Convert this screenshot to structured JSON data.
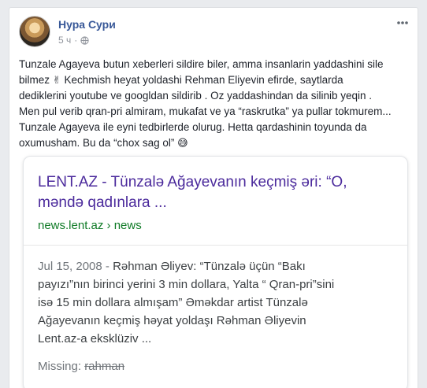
{
  "post": {
    "author": "Нура Сури",
    "time": "5 ч",
    "separator": "·",
    "lines": [
      "Tunzale Agayeva butun xeberleri sildire biler, amma insanlarin yaddashini sile",
      "bilmez",
      " Kechmish heyat yoldashi Rehman Eliyevin efirde, saytlarda",
      "dediklerini youtube ve googldan sildirib . Oz yaddashindan da silinib yeqin .",
      "Men pul verib qran-pri almiram, mukafat ve ya “raskrutka” ya pullar tokmurem...",
      "Tunzale Agayeva ile eyni tedbirlerde olurug. Hetta qardashinin toyunda da",
      "oxumusham. Bu da “chox sag ol”"
    ],
    "emoji_victory": "✌",
    "emoji_face": "😅"
  },
  "card": {
    "title_line1": "LENT.AZ - Tünzalə Ağayevanın keçmiş əri: “O,",
    "title_line2": "məndə qadınlara ...",
    "url": "news.lent.az › news",
    "date": "Jul 15, 2008",
    "date_sep": " - ",
    "snippet_line1": "Rəhman Əliyev: “Tünzalə üçün “Bakı",
    "snippet_line2": "payızı”nın birinci yerini 3 min dollara, Yalta “ Qran-pri”sini",
    "snippet_line3": "isə 15 min dollara almışam” Əməkdar artist Tünzalə",
    "snippet_line4": "Ağayevanın keçmiş həyat yoldaşı Rəhman Əliyevin",
    "snippet_line5": "Lent.az-a eksklüziv ...",
    "missing_label": "Missing: ",
    "missing_term": "rahman"
  },
  "icons": {
    "avatar": "avatar-photo",
    "privacy": "globe-icon",
    "menu": "more-options-icon"
  },
  "colors": {
    "author": "#385898",
    "card_title": "#4b2a9c",
    "card_url": "#0f7a26"
  }
}
